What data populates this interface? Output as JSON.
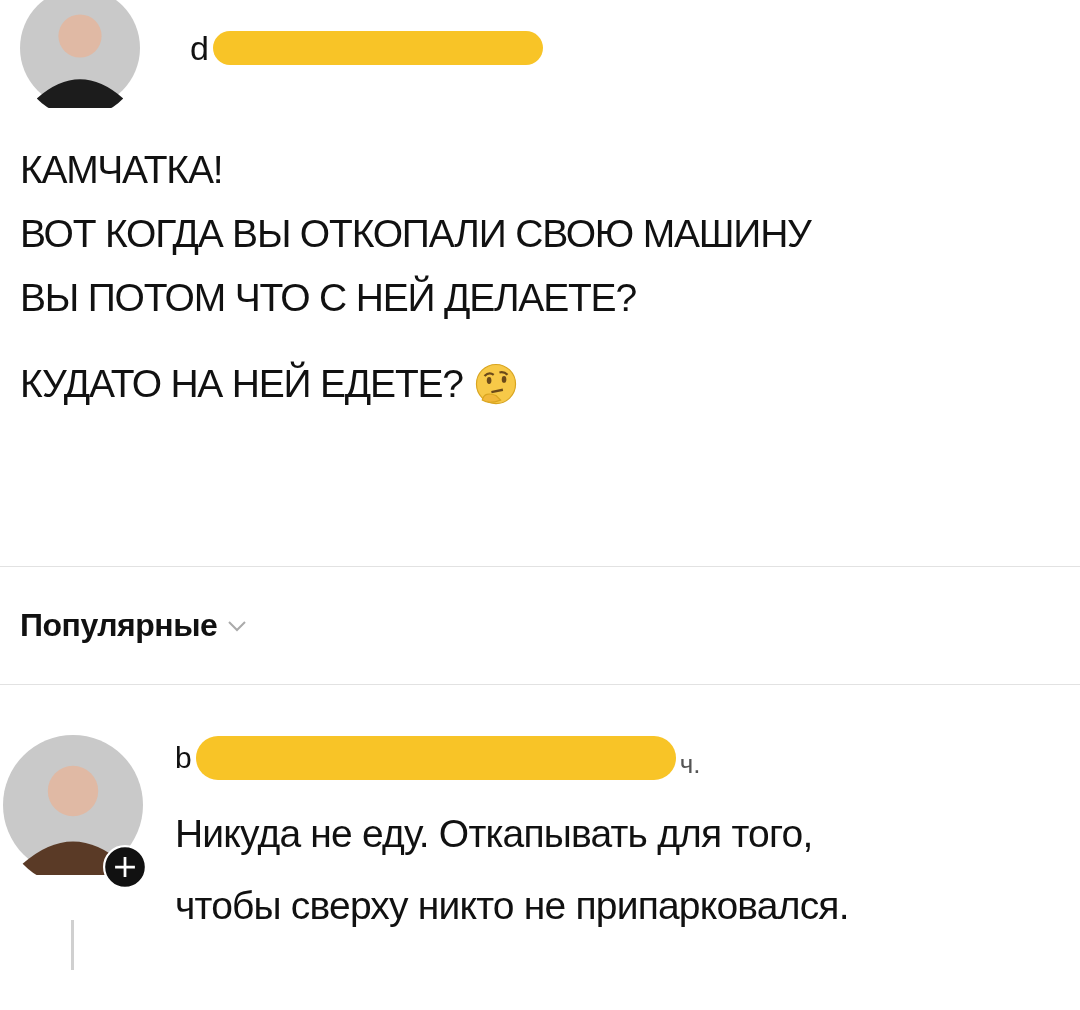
{
  "post": {
    "author": {
      "username": "d",
      "redacted": true
    },
    "paragraphs": [
      {
        "lines": [
          "КАМЧАТКА!",
          "ВОТ КОГДА ВЫ ОТКОПАЛИ СВОЮ МАШИНУ",
          "ВЫ ПОТОМ ЧТО С НЕЙ ДЕЛАЕТЕ?"
        ]
      },
      {
        "lines": [
          "КУДАТО НА НЕЙ ЕДЕТЕ?"
        ]
      }
    ]
  },
  "sort": {
    "label": "Популярные"
  },
  "comments": [
    {
      "author": {
        "username": "b",
        "username_end": "ч.",
        "redacted": true
      },
      "lines": [
        "Никуда не еду. Откапывать для того,",
        "чтобы сверху никто не припарковался."
      ]
    }
  ]
}
